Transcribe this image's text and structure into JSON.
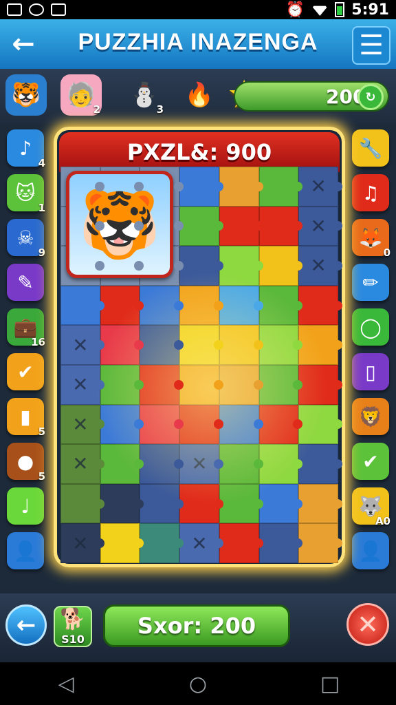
{
  "status_bar": {
    "time": "5:91"
  },
  "header": {
    "title": "PUZZHIA INAZENGA",
    "back_icon": "arrow-left-icon",
    "menu_icon": "hamburger-menu-icon"
  },
  "top_players": [
    {
      "name": "tiger-avatar",
      "glyph": "🐯",
      "count": "",
      "bg": "#2a7fd0"
    },
    {
      "name": "elder-avatar",
      "glyph": "🧓",
      "count": "2",
      "bg": "#f6a8c0"
    },
    {
      "name": "snowman-avatar",
      "glyph": "⛄",
      "count": "3",
      "bg": "transparent"
    },
    {
      "name": "flame-avatar",
      "glyph": "🔥",
      "count": "",
      "bg": "transparent"
    }
  ],
  "coins": {
    "value": "200",
    "icon": "star-icon",
    "add_icon": "coin-add-icon"
  },
  "left_tools": [
    {
      "name": "music-note-tool",
      "glyph": "♪",
      "count": "4",
      "bg": "#2a8ae0"
    },
    {
      "name": "cat-tool",
      "glyph": "🐱",
      "count": "1",
      "bg": "#5cc23a"
    },
    {
      "name": "skull-tool",
      "glyph": "☠",
      "count": "9",
      "bg": "#2a6ad0"
    },
    {
      "name": "brush-tool",
      "glyph": "✎",
      "count": "",
      "bg": "#7a3ac8"
    },
    {
      "name": "briefcase-tool",
      "glyph": "💼",
      "count": "16",
      "bg": "#3aa83a"
    },
    {
      "name": "check-diamond-tool",
      "glyph": "✔",
      "count": "",
      "bg": "#f2a21a"
    },
    {
      "name": "card-tool",
      "glyph": "▮",
      "count": "5",
      "bg": "#f2a21a"
    },
    {
      "name": "bomb-tool",
      "glyph": "●",
      "count": "5",
      "bg": "#a8501a"
    },
    {
      "name": "note-tool",
      "glyph": "♩",
      "count": "",
      "bg": "#6ad83a"
    },
    {
      "name": "user-tool",
      "glyph": "👤",
      "count": "",
      "bg": "#2a7ad8"
    }
  ],
  "right_tools": [
    {
      "name": "wrench-tool",
      "glyph": "🔧",
      "count": "",
      "bg": "#f2c21a"
    },
    {
      "name": "music-tool",
      "glyph": "♫",
      "count": "",
      "bg": "#e02a1a"
    },
    {
      "name": "fox-tool",
      "glyph": "🦊",
      "count": "0",
      "bg": "#e86a1a"
    },
    {
      "name": "pencil-tool",
      "glyph": "✏",
      "count": "",
      "bg": "#2a8ae0"
    },
    {
      "name": "ring-tool",
      "glyph": "◯",
      "count": "",
      "bg": "#3ab83a"
    },
    {
      "name": "bar-tool",
      "glyph": "▯",
      "count": "",
      "bg": "#7a3ac8"
    },
    {
      "name": "lion-tool",
      "glyph": "🦁",
      "count": "",
      "bg": "#e8801a"
    },
    {
      "name": "check-tool",
      "glyph": "✔",
      "count": "",
      "bg": "#5cc23a"
    },
    {
      "name": "wolf-tool",
      "glyph": "🐺",
      "count": "A0",
      "bg": "#f2c21a"
    },
    {
      "name": "user-right-tool",
      "glyph": "👤",
      "count": "",
      "bg": "#2a7ad8"
    }
  ],
  "board": {
    "title": "PXZL&: 900",
    "portrait_icon": "tiger-portrait-icon",
    "portrait_glyph": "🐯",
    "tiles": [
      [
        "#7a8fb0",
        "#7a8fb0",
        "#7a8fb0",
        "#3c7ad8",
        "#e8a030",
        "#5ab83a",
        "#3c5a9a"
      ],
      [
        "#7a8fb0",
        "#7a8fb0",
        "#7a8fb0",
        "#5ab83a",
        "#e02a1a",
        "#e02a1a",
        "#3c5a9a"
      ],
      [
        "#7a8fb0",
        "#7a8fb0",
        "#7a8fb0",
        "#3c5a9a",
        "#8ed840",
        "#f2c21a",
        "#3c5a9a"
      ],
      [
        "#3c7ad8",
        "#e02a1a",
        "#3c7ad8",
        "#f2a21a",
        "#4aa8e8",
        "#5ab83a",
        "#e02a1a"
      ],
      [
        "#4a6ab0",
        "#e83a4a",
        "#3c5a9a",
        "#f2d21a",
        "#f2c21a",
        "#8ed840",
        "#f2a21a"
      ],
      [
        "#4a6ab0",
        "#5ab83a",
        "#e02a1a",
        "#f2a21a",
        "#e8a030",
        "#5ab83a",
        "#e02a1a"
      ],
      [
        "#5a8a3a",
        "#3c7ad8",
        "#e83a4a",
        "#e02a1a",
        "#3c7ad8",
        "#e02a1a",
        "#8ed840"
      ],
      [
        "#5a8a3a",
        "#5ab83a",
        "#3c5a9a",
        "#4a6ab0",
        "#5ab83a",
        "#8ed840",
        "#3c5a9a"
      ],
      [
        "#5a8a3a",
        "#2c3c5a",
        "#3c5a9a",
        "#e02a1a",
        "#5ab83a",
        "#3c7ad8",
        "#e8a030"
      ],
      [
        "#2c3c5a",
        "#f2d21a",
        "#3c8a7a",
        "#4a6ab0",
        "#e02a1a",
        "#3c5a9a",
        "#e8a030"
      ]
    ],
    "x_marks": [
      [
        0,
        6
      ],
      [
        1,
        6
      ],
      [
        2,
        6
      ],
      [
        4,
        0
      ],
      [
        5,
        0
      ],
      [
        6,
        0
      ],
      [
        7,
        3
      ],
      [
        7,
        0
      ],
      [
        9,
        0
      ],
      [
        9,
        3
      ]
    ]
  },
  "bottom": {
    "back_icon": "arrow-left-icon",
    "item_icon": "dog-icon",
    "item_glyph": "🐕",
    "item_count": "S10",
    "score_label": "Sxor: 200",
    "close_icon": "close-x-icon"
  },
  "nav": {
    "back_icon": "nav-back-icon",
    "home_icon": "nav-home-icon",
    "recents_icon": "nav-recents-icon"
  }
}
